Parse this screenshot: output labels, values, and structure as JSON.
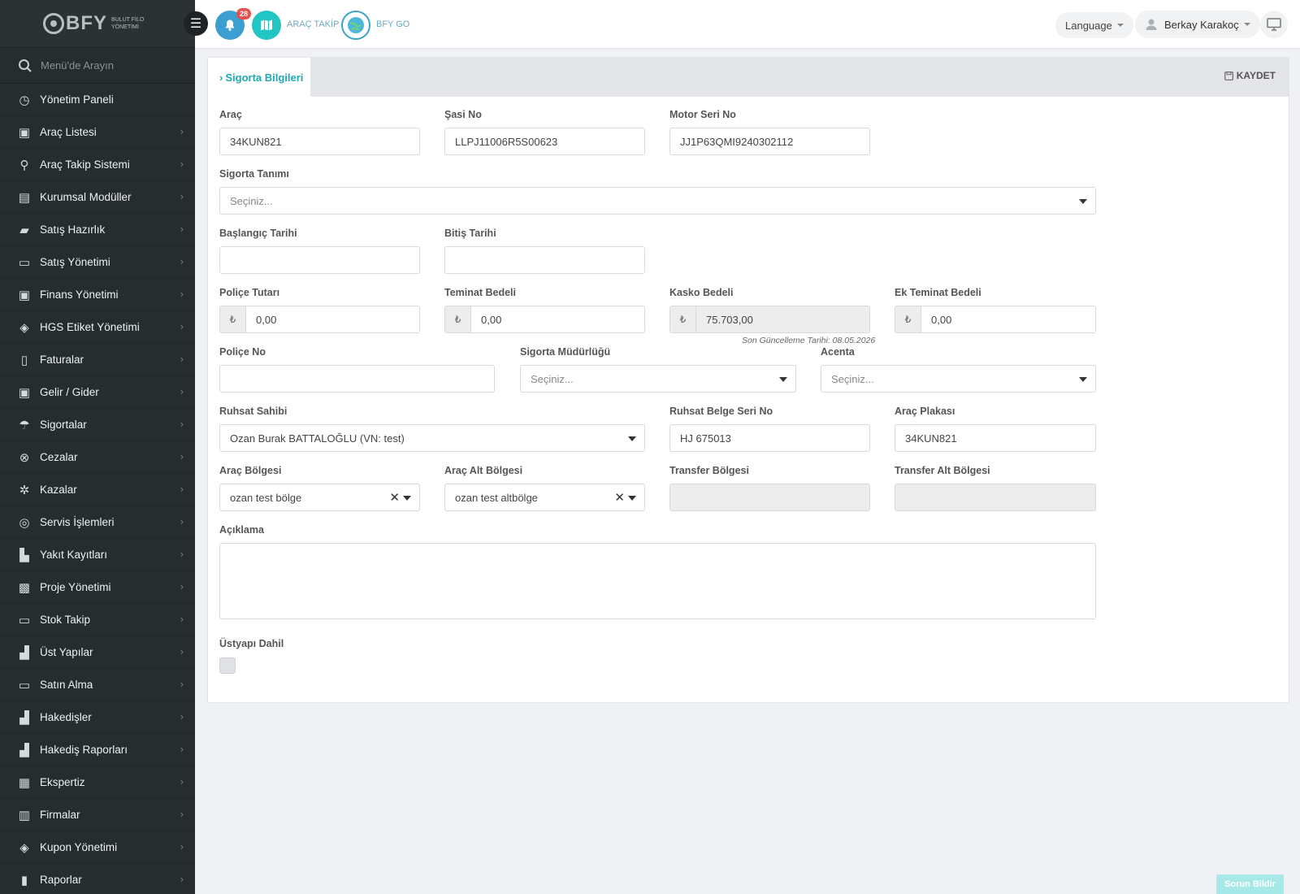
{
  "brand": {
    "name": "BFY",
    "subtitle": "BULUT FİLO YÖNETİMİ"
  },
  "sidebar": {
    "search_placeholder": "Menü'de Arayın",
    "items": [
      {
        "label": "Yönetim Paneli",
        "icon": "dashboard-icon"
      },
      {
        "label": "Araç Listesi",
        "icon": "bus-icon"
      },
      {
        "label": "Araç Takip Sistemi",
        "icon": "map-pin-icon"
      },
      {
        "label": "Kurumsal Modüller",
        "icon": "server-icon"
      },
      {
        "label": "Satış Hazırlık",
        "icon": "book-icon"
      },
      {
        "label": "Satış Yönetimi",
        "icon": "credit-card-icon"
      },
      {
        "label": "Finans Yönetimi",
        "icon": "money-icon"
      },
      {
        "label": "HGS Etiket Yönetimi",
        "icon": "tag-icon"
      },
      {
        "label": "Faturalar",
        "icon": "file-icon"
      },
      {
        "label": "Gelir / Gider",
        "icon": "cash-icon"
      },
      {
        "label": "Sigortalar",
        "icon": "umbrella-icon"
      },
      {
        "label": "Cezalar",
        "icon": "cross-circle-icon"
      },
      {
        "label": "Kazalar",
        "icon": "car-crash-icon"
      },
      {
        "label": "Servis İşlemleri",
        "icon": "check-circle-icon"
      },
      {
        "label": "Yakıt Kayıtları",
        "icon": "fuel-icon"
      },
      {
        "label": "Proje Yönetimi",
        "icon": "briefcase-icon"
      },
      {
        "label": "Stok Takip",
        "icon": "inbox-icon"
      },
      {
        "label": "Üst Yapılar",
        "icon": "truck-icon"
      },
      {
        "label": "Satın Alma",
        "icon": "credit-card-icon"
      },
      {
        "label": "Hakedişler",
        "icon": "truck-icon"
      },
      {
        "label": "Hakediş Raporları",
        "icon": "truck-icon"
      },
      {
        "label": "Ekspertiz",
        "icon": "list-icon"
      },
      {
        "label": "Firmalar",
        "icon": "building-icon"
      },
      {
        "label": "Kupon Yönetimi",
        "icon": "ticket-icon"
      },
      {
        "label": "Raporlar",
        "icon": "bar-chart-icon"
      }
    ]
  },
  "topbar": {
    "notification_count": "28",
    "arac_takip": "ARAÇ TAKİP",
    "bfy_go": "BFY GO",
    "language": "Language",
    "user": "Berkay Karakoç"
  },
  "panel": {
    "tab": "Sigorta Bilgileri",
    "save": "KAYDET"
  },
  "form": {
    "arac_label": "Araç",
    "arac_value": "34KUN821",
    "sasi_label": "Şasi No",
    "sasi_value": "LLPJ11006R5S00623",
    "motor_label": "Motor Seri No",
    "motor_value": "JJ1P63QMI9240302112",
    "tanim_label": "Sigorta Tanımı",
    "tanim_placeholder": "Seçiniz...",
    "baslangic_label": "Başlangıç Tarihi",
    "baslangic_value": "",
    "bitis_label": "Bitiş Tarihi",
    "bitis_value": "",
    "currency": "₺",
    "police_tutari_label": "Poliçe Tutarı",
    "police_tutari_value": "0,00",
    "teminat_label": "Teminat Bedeli",
    "teminat_value": "0,00",
    "kasko_label": "Kasko Bedeli",
    "kasko_value": "75.703,00",
    "kasko_hint": "Son Güncelleme Tarihi: 08.05.2026",
    "ek_teminat_label": "Ek Teminat Bedeli",
    "ek_teminat_value": "0,00",
    "police_no_label": "Poliçe No",
    "police_no_value": "",
    "mudurluk_label": "Sigorta Müdürlüğü",
    "mudurluk_placeholder": "Seçiniz...",
    "acenta_label": "Acenta",
    "acenta_placeholder": "Seçiniz...",
    "ruhsat_sahibi_label": "Ruhsat Sahibi",
    "ruhsat_sahibi_value": "Ozan Burak BATTALOĞLU (VN: test)",
    "ruhsat_seri_label": "Ruhsat Belge Seri No",
    "ruhsat_seri_value": "HJ 675013",
    "plaka_label": "Araç Plakası",
    "plaka_value": "34KUN821",
    "bolge_label": "Araç Bölgesi",
    "bolge_value": "ozan test bölge",
    "alt_bolge_label": "Araç Alt Bölgesi",
    "alt_bolge_value": "ozan test altbölge",
    "transfer_bolge_label": "Transfer Bölgesi",
    "transfer_bolge_value": "",
    "transfer_alt_label": "Transfer Alt Bölgesi",
    "transfer_alt_value": "",
    "aciklama_label": "Açıklama",
    "aciklama_value": "",
    "ustyapi_label": "Üstyapı Dahil",
    "ustyapi_checked": false
  },
  "footer": {
    "report_button": "Sorun Bildir"
  },
  "colors": {
    "accent": "#1fa9b3",
    "sidebar_bg": "#262d2f",
    "page_bg": "#f0f1f5"
  }
}
